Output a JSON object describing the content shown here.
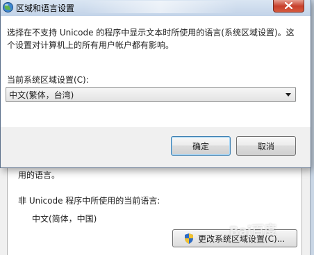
{
  "dialog": {
    "title": "区域和语言设置",
    "description": "选择在不支持 Unicode 的程序中显示文本时所使用的语言(系统区域设置)。这个设置对计算机上的所有用户帐户都有影响。",
    "current_label": "当前系统区域设置(C):",
    "current_value": "中文(繁体，台湾)",
    "ok_label": "确定",
    "cancel_label": "取消"
  },
  "background": {
    "partial_text": "用的语言。",
    "non_unicode_label": "非 Unicode 程序中所使用的当前语言:",
    "current_language": "中文(简体，中国)",
    "change_button_label": "更改系统区域设置(C)..."
  },
  "icons": {
    "app": "globe-icon",
    "close": "close-icon",
    "shield": "shield-icon",
    "dropdown": "chevron-down-icon"
  },
  "colors": {
    "close_red": "#c7402c",
    "titlebar": "#c2d3e8",
    "default_button_border": "#3c7fb1"
  }
}
